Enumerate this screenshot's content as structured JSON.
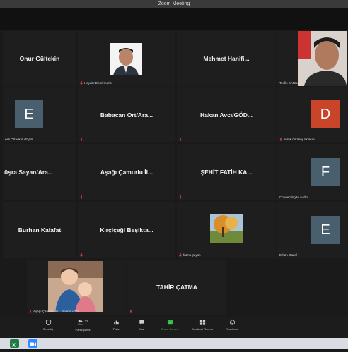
{
  "window": {
    "title": "Zoom Meeting"
  },
  "tiles": [
    {
      "name": "Onur Gültekin",
      "label": ""
    },
    {
      "name": "",
      "label": "Haydar Demirmeric"
    },
    {
      "name": "Mehmet Hanifi...",
      "label": ""
    },
    {
      "name": "",
      "label": "Tevfik SARSAÇ"
    },
    {
      "name": "",
      "label": "eeli Ortaokulu-Eyyü...",
      "avatar": "E"
    },
    {
      "name": "Babacan Ort/Ara...",
      "label": ""
    },
    {
      "name": "Hakan Avcı/GÖD...",
      "label": ""
    },
    {
      "name": "",
      "label": "aralık Ortaköy İlkokulu",
      "avatar": "D"
    },
    {
      "name": "üşra Sayan/Ara...",
      "label": ""
    },
    {
      "name": "Aşağı Çamurlu İl...",
      "label": ""
    },
    {
      "name": "ŞEHİT FATİH KA...",
      "label": ""
    },
    {
      "name": "",
      "label": "Connecting to audio ...",
      "avatar": "F"
    },
    {
      "name": "Burhan Kalafat",
      "label": ""
    },
    {
      "name": "Kırçiçeği Beşikta...",
      "label": ""
    },
    {
      "name": "",
      "label": "fatma şeyan"
    },
    {
      "name": "",
      "label": "Erkan Gazel",
      "avatar": "E"
    },
    {
      "name": "",
      "label": "Aşağı Çamurlu İlk... İlkokulu-Ozl..."
    },
    {
      "name": "TAHİR ÇATMA",
      "label": ""
    }
  ],
  "toolbar": {
    "items": [
      {
        "label": "Security",
        "icon": "shield-icon"
      },
      {
        "label": "Participants",
        "icon": "participants-icon",
        "count": "22"
      },
      {
        "label": "Polls",
        "icon": "polls-icon"
      },
      {
        "label": "Chat",
        "icon": "chat-icon"
      },
      {
        "label": "Share Screen",
        "icon": "share-screen-icon"
      },
      {
        "label": "Breakout Rooms",
        "icon": "breakout-rooms-icon"
      },
      {
        "label": "Reactions",
        "icon": "reactions-icon"
      }
    ]
  },
  "taskbar": {
    "apps": [
      "excel-icon",
      "zoom-icon"
    ]
  },
  "colors": {
    "avatar_e": "#4a5f6e",
    "avatar_d": "#c8452a",
    "avatar_f": "#4a5f6e",
    "share_green": "#2fbf4a",
    "mic_red": "#e03a3a"
  }
}
